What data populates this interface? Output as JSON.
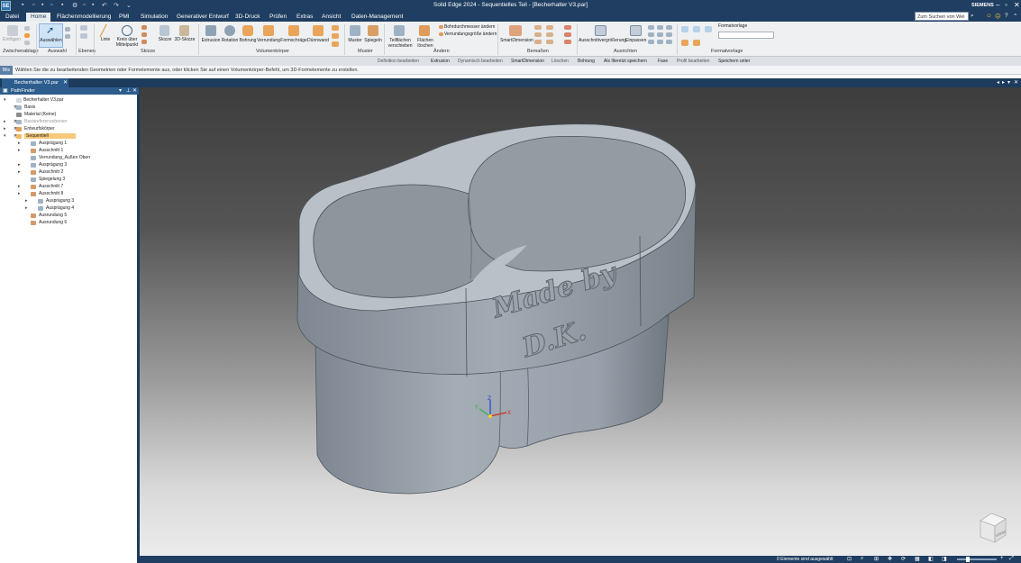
{
  "window": {
    "title": "Solid Edge 2024 - Sequentielles Teil - [Becherhalter V3.par]",
    "brand": "SIEMENS",
    "app_badge": "SE",
    "search_placeholder": "Zum Suchen von Wei"
  },
  "menu": {
    "tabs": [
      "Datei",
      "Home",
      "Flächenmodellierung",
      "PMI",
      "Simulation",
      "Generativer Entwurf",
      "3D-Druck",
      "Prüfen",
      "Extras",
      "Ansicht",
      "Daten-Management"
    ],
    "active": "Home"
  },
  "ribbon": {
    "buttons": {
      "einfuegen": "Einfügen",
      "auswaehlen": "Auswählen",
      "linie": "Linie",
      "kreis": "Kreis über Mittelpunkt",
      "skizze": "Skizze",
      "skizze3d": "3D-Skizze",
      "extrusion": "Extrusion",
      "rotation": "Rotation",
      "bohrung": "Bohrung",
      "verrundung": "Verrundung",
      "formschraege": "Formschräge",
      "duennwand": "Dünnwand",
      "muster": "Muster",
      "spiegeln": "Spiegeln",
      "teilflaechen": "Teilflächen verschieben",
      "flaechen_loeschen": "Flächen löschen",
      "bohrdurchmesser": "Bohrdurchmesser ändern",
      "verrundungsgroesse": "Verrundungsgröße ändern",
      "smartdimension": "SmartDimension",
      "ausschnittvergroesserung": "Ausschnittvergrößerung",
      "einpassen": "Einpassen",
      "formatvorlage": "Formatvorlage"
    },
    "groups": {
      "zwischenablage": "Zwischenablage",
      "auswahl": "Auswahl",
      "ebenen": "Ebenen",
      "skizze": "Skizze",
      "volumenkoerper": "Volumenkörper",
      "muster": "Muster",
      "aendern": "Ändern",
      "bemassen": "Bemaßen",
      "ausrichten": "Ausrichten",
      "formatvorlage": "Formatvorlage"
    }
  },
  "commandbar": {
    "items": [
      "Definition bearbeiten",
      "Extrusion",
      "Dynamisch bearbeiten",
      "SmartDimension",
      "Löschen",
      "Bohrung",
      "Als Ilteretzt speichern",
      "Fase",
      "Profil bearbeiten",
      "Speichern unter"
    ]
  },
  "prompt": {
    "label": "Bits",
    "text": "Wählen Sie die zu bearbeitenden Geometrien oder Formelemente aus, oder klicken Sie auf einen Volumenkörper-Befehl, um 3D-Formelemente zu erstellen."
  },
  "document_tab": {
    "label": "Becherhalter V3.par"
  },
  "pathfinder": {
    "title": "PathFinder",
    "root": "Becherhalter V3.par",
    "items": [
      {
        "label": "Basis",
        "color": "#a7b6c6"
      },
      {
        "label": "Material (Keine)",
        "color": "#8a8a8a"
      },
      {
        "label": "Basisreferenzebenen",
        "color": "#a7b6c6"
      },
      {
        "label": "Entwurfskörper",
        "color": "#e0a060"
      },
      {
        "label": "Sequentiell",
        "color": "#f1b968"
      },
      {
        "label": "Ausprägung 1",
        "color": "#9fb2c4"
      },
      {
        "label": "Ausschnitt 1",
        "color": "#d49a6a"
      },
      {
        "label": "Verrundung_Außen Oben",
        "color": "#9fb2c4"
      },
      {
        "label": "Ausprägung 3",
        "color": "#9fb2c4"
      },
      {
        "label": "Ausschnitt 2",
        "color": "#d49a6a"
      },
      {
        "label": "Spiegelung 3",
        "color": "#9fb2c4"
      },
      {
        "label": "Ausschnitt 7",
        "color": "#d49a6a"
      },
      {
        "label": "Ausschnitt 8",
        "color": "#d49a6a"
      },
      {
        "label": "Ausprägung 3",
        "color": "#9fb2c4"
      },
      {
        "label": "Ausprägung 4",
        "color": "#9fb2c4"
      },
      {
        "label": "Ausrundung 5",
        "color": "#d49a6a"
      },
      {
        "label": "Ausrundung 6",
        "color": "#d49a6a"
      }
    ]
  },
  "model": {
    "embossed_line1": "Made by",
    "embossed_line2": "D.K.",
    "axis_x": "X",
    "axis_y": "Y",
    "axis_z": "Z",
    "cube_label": "VORNE"
  },
  "status": {
    "text": "0 Elemente sind ausgewählt"
  }
}
